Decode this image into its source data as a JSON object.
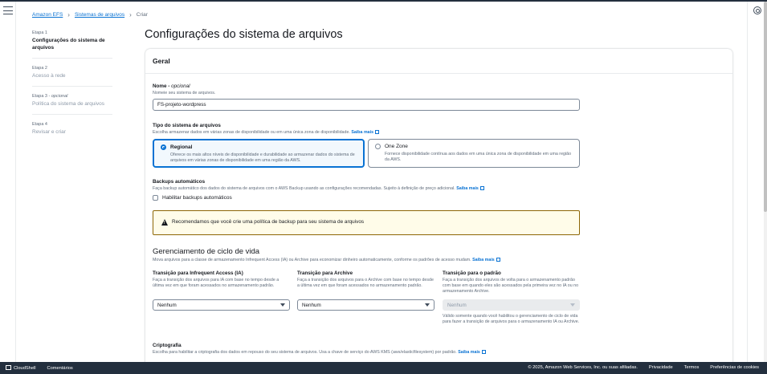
{
  "breadcrumb": {
    "item1": "Amazon EFS",
    "item2": "Sistemas de arquivos",
    "current": "Criar"
  },
  "steps": [
    {
      "num": "Etapa 1",
      "optional": "",
      "title": "Configurações do sistema de arquivos"
    },
    {
      "num": "Etapa 2",
      "optional": "",
      "title": "Acesso à rede"
    },
    {
      "num": "Etapa 3 -",
      "optional": "opcional",
      "title": "Política do sistema de arquivos"
    },
    {
      "num": "Etapa 4",
      "optional": "",
      "title": "Revisar e criar"
    }
  ],
  "page_title": "Configurações do sistema de arquivos",
  "general": {
    "header": "Geral",
    "name_label": "Nome -",
    "name_optional": "opcional",
    "name_desc": "Nomeie seu sistema de arquivos.",
    "name_value": "FS-projeto-wordpress",
    "type_label": "Tipo do sistema de arquivos",
    "type_desc": "Escolha armazenar dados em várias zonas de disponibilidade ou em uma única zona de disponibilidade.",
    "learn_more": "Saiba mais",
    "regional_title": "Regional",
    "regional_desc": "Oferece os mais altos níveis de disponibilidade e durabilidade ao armazenar dados do sistema de arquivos em várias zonas de disponibilidade em uma região da AWS.",
    "onezone_title": "One Zone",
    "onezone_desc": "Fornece disponibilidade contínua aos dados em uma única zona de disponibilidade em uma região da AWS.",
    "backup_label": "Backups automáticos",
    "backup_desc": "Faça backup automático dos dados do sistema de arquivos com o AWS Backup usando as configurações recomendadas. Sujeito à definição de preço adicional.",
    "backup_checkbox": "Habilitar backups automáticos",
    "alert_text": "Recomendamos que você crie uma política de backup para seu sistema de arquivos"
  },
  "lifecycle": {
    "title": "Gerenciamento de ciclo de vida",
    "desc": "Mova arquivos para a classe de armazenamento Infrequent Access (IA) ou Archive para economizar dinheiro automaticamente, conforme os padrões de acesso mudam.",
    "ia_label": "Transição para Infrequent Access (IA)",
    "ia_desc": "Faça a transição dos arquivos para IA com base no tempo desde a última vez em que foram acessados no armazenamento padrão.",
    "ia_value": "Nenhum",
    "archive_label": "Transição para Archive",
    "archive_desc": "Faça a transição dos arquivos para o Archive com base no tempo desde a última vez em que foram acessados no armazenamento padrão.",
    "archive_value": "Nenhum",
    "standard_label": "Transição para o padrão",
    "standard_desc": "Faça a transição dos arquivos de volta para o armazenamento padrão com base em quando eles são acessados pela primeira vez no IA ou no armazenamento Archive.",
    "standard_value": "Nenhum",
    "standard_note": "Válido somente quando você habilitou o gerenciamento de ciclo de vida para fazer a transição de arquivos para o armazenamento IA ou Archive."
  },
  "encryption": {
    "label": "Criptografia",
    "desc": "Escolha para habilitar a criptografia dos dados em repouso do seu sistema de arquivos. Usa a chave de serviço do AWS KMS (aws/elasticfilesystem) por padrão."
  },
  "footer": {
    "cloudshell": "CloudShell",
    "comments": "Comentários",
    "copyright": "© 2025, Amazon Web Services, Inc. ou suas afiliadas.",
    "privacy": "Privacidade",
    "terms": "Termos",
    "cookies": "Preferências de cookies"
  }
}
